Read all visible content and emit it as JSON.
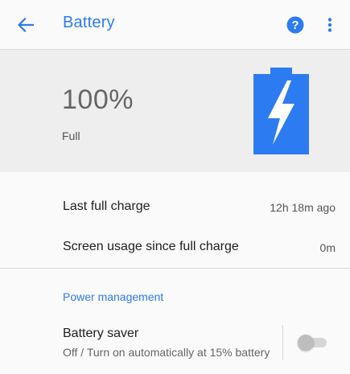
{
  "app_bar": {
    "title": "Battery",
    "back_icon": "arrow-back-icon",
    "help_icon": "help-icon",
    "more_icon": "more-vert-icon",
    "accent_color": "#2d7bf0"
  },
  "summary": {
    "level": "100%",
    "status": "Full",
    "battery_icon": "battery-charging-icon",
    "battery_color": "#2d7bf0",
    "background_color": "#eeeeee"
  },
  "details": {
    "last_full_charge": {
      "label": "Last full charge",
      "value": "12h 18m ago"
    },
    "screen_usage": {
      "label": "Screen usage since full charge",
      "value": "0m"
    }
  },
  "power_management": {
    "header": "Power management",
    "battery_saver": {
      "title": "Battery saver",
      "summary": "Off / Turn on automatically at 15% battery",
      "toggle_state": "off"
    }
  }
}
